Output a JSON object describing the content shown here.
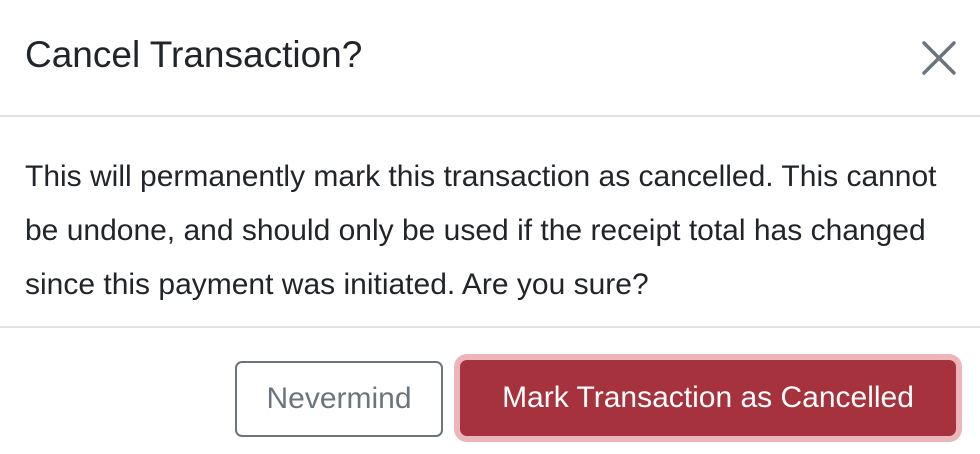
{
  "modal": {
    "title": "Cancel Transaction?",
    "message": "This will permanently mark this transaction as cancelled. This cannot be undone, and should only be used if the receipt total has changed since this payment was initiated. Are you sure?",
    "close_icon": "close-icon",
    "buttons": {
      "nevermind_label": "Nevermind",
      "confirm_label": "Mark Transaction as Cancelled"
    }
  },
  "colors": {
    "text": "#212529",
    "divider": "#dee2e6",
    "secondary": "#6c757d",
    "danger": "#a6323d",
    "danger_focus_ring": "#e0878f"
  }
}
